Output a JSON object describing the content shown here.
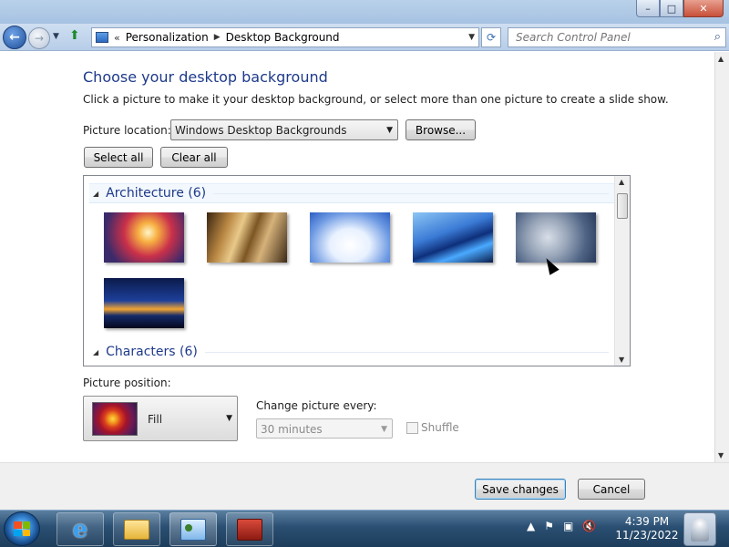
{
  "window": {
    "minimize_label": "–",
    "maximize_label": "□",
    "close_label": "✕"
  },
  "navbar": {
    "back_icon": "back-arrow-icon",
    "forward_icon": "forward-arrow-icon",
    "address": {
      "chevron": "«",
      "segments": [
        "Personalization",
        "Desktop Background"
      ]
    },
    "search_placeholder": "Search Control Panel"
  },
  "page": {
    "title": "Choose your desktop background",
    "description": "Click a picture to make it your desktop background, or select more than one picture to create a slide show.",
    "picture_location": {
      "label": "Picture location:",
      "value": "Windows Desktop Backgrounds"
    },
    "browse_label": "Browse...",
    "select_all_label": "Select all",
    "clear_all_label": "Clear all",
    "groups": [
      {
        "name": "Architecture (6)",
        "thumbnails": 6
      },
      {
        "name": "Characters (6)"
      }
    ],
    "picture_position": {
      "label": "Picture position:",
      "value": "Fill"
    },
    "change_picture": {
      "label": "Change picture every:",
      "value": "30 minutes"
    },
    "shuffle_label": "Shuffle"
  },
  "footer": {
    "save_label": "Save changes",
    "cancel_label": "Cancel"
  },
  "taskbar": {
    "items": [
      "internet-explorer",
      "windows-explorer",
      "control-panel",
      "toolbox"
    ],
    "clock_time": "4:39 PM",
    "clock_date": "11/23/2022"
  },
  "colors": {
    "heading": "#1e3a8a",
    "accent": "#3c7fb1",
    "taskbar": "#2a4f72"
  }
}
